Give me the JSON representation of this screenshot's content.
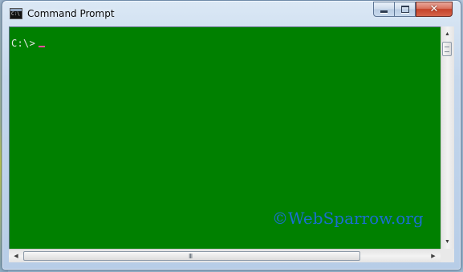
{
  "window": {
    "title": "Command Prompt",
    "controls": {
      "minimize": "minimize",
      "maximize": "maximize",
      "close": "✕"
    }
  },
  "console": {
    "prompt": "C:\\>",
    "background_color": "#008000",
    "text_color": "#e8e8e8"
  },
  "watermark": "©WebSparrow.org",
  "scrollbars": {
    "vertical_arrow_up": "▲",
    "vertical_arrow_down": "▼",
    "horizontal_arrow_left": "◀",
    "horizontal_arrow_right": "▶",
    "horizontal_grip": "III"
  },
  "icons": {
    "app": "cmd-app-icon"
  }
}
